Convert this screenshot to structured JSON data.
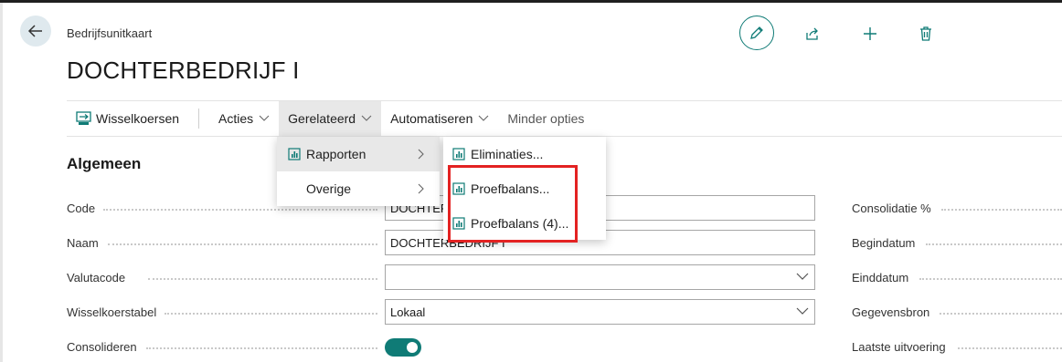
{
  "page": {
    "breadcrumb": "Bedrijfsunitkaart",
    "title": "DOCHTERBEDRIJF I"
  },
  "header_actions": {
    "back_icon": "arrow-left-icon",
    "edit_icon": "pencil-icon",
    "share_icon": "share-icon",
    "add_icon": "plus-icon",
    "delete_icon": "trash-icon",
    "accent_color": "#0f7b76"
  },
  "menubar": {
    "items": [
      {
        "label": "Wisselkoersen",
        "icon": "exchange-rates-icon"
      },
      {
        "label": "Acties"
      },
      {
        "label": "Gerelateerd",
        "active": true
      },
      {
        "label": "Automatiseren"
      },
      {
        "label": "Minder opties"
      }
    ]
  },
  "dropdown_related": {
    "items": [
      {
        "label": "Rapporten",
        "icon": "report-icon",
        "active": true
      },
      {
        "label": "Overige"
      }
    ]
  },
  "dropdown_reports": {
    "items": [
      {
        "label": "Eliminaties...",
        "icon": "report-icon"
      },
      {
        "label": "Proefbalans...",
        "icon": "report-icon"
      },
      {
        "label": "Proefbalans (4)...",
        "icon": "report-icon"
      }
    ],
    "highlight_color": "#e32222"
  },
  "section": {
    "title": "Algemeen"
  },
  "fields_left": [
    {
      "label": "Code",
      "value": "DOCHTEF"
    },
    {
      "label": "Naam",
      "value": "DOCHTERBEDRIJF I"
    },
    {
      "label": "Valutacode",
      "value": ""
    },
    {
      "label": "Wisselkoerstabel",
      "value": "Lokaal"
    },
    {
      "label": "Consolideren",
      "value": "on"
    }
  ],
  "fields_right": [
    {
      "label": "Consolidatie %"
    },
    {
      "label": "Begindatum"
    },
    {
      "label": "Einddatum"
    },
    {
      "label": "Gegevensbron"
    },
    {
      "label": "Laatste uitvoering"
    }
  ]
}
